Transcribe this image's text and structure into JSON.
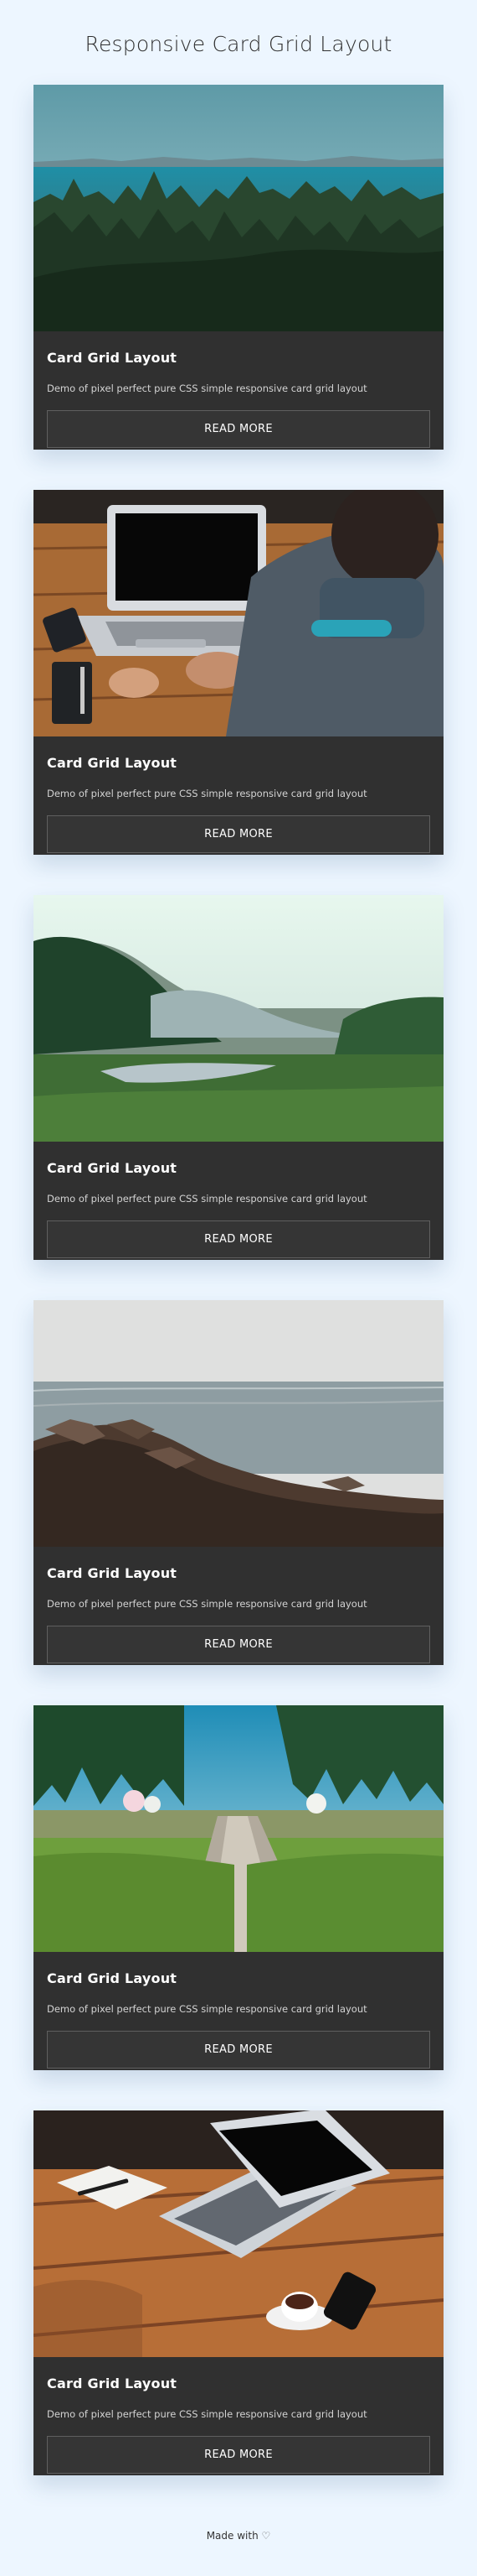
{
  "page": {
    "title": "Responsive Card Grid Layout",
    "footer_text": "Made with",
    "footer_heart": "♡"
  },
  "cards": [
    {
      "title": "Card Grid Layout",
      "description": "Demo of pixel perfect pure CSS simple responsive card grid layout",
      "button_label": "READ MORE",
      "image_subject": "forest-lake-landscape"
    },
    {
      "title": "Card Grid Layout",
      "description": "Demo of pixel perfect pure CSS simple responsive card grid layout",
      "button_label": "READ MORE",
      "image_subject": "laptop-workspace"
    },
    {
      "title": "Card Grid Layout",
      "description": "Demo of pixel perfect pure CSS simple responsive card grid layout",
      "button_label": "READ MORE",
      "image_subject": "mountain-valley"
    },
    {
      "title": "Card Grid Layout",
      "description": "Demo of pixel perfect pure CSS simple responsive card grid layout",
      "button_label": "READ MORE",
      "image_subject": "rocky-shore"
    },
    {
      "title": "Card Grid Layout",
      "description": "Demo of pixel perfect pure CSS simple responsive card grid layout",
      "button_label": "READ MORE",
      "image_subject": "forest-path"
    },
    {
      "title": "Card Grid Layout",
      "description": "Demo of pixel perfect pure CSS simple responsive card grid layout",
      "button_label": "READ MORE",
      "image_subject": "laptop-coffee-table"
    }
  ],
  "colors": {
    "page_background": "#edf6ff",
    "card_background": "#303030",
    "button_border": "#5f5f5f",
    "title_color": "#ffffff",
    "description_color": "#d3d3d3"
  }
}
